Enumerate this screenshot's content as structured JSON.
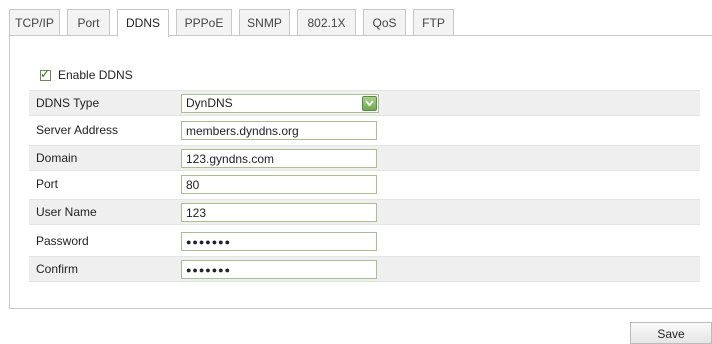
{
  "tabs": [
    {
      "label": "TCP/IP",
      "active": false
    },
    {
      "label": "Port",
      "active": false
    },
    {
      "label": "DDNS",
      "active": true
    },
    {
      "label": "PPPoE",
      "active": false
    },
    {
      "label": "SNMP",
      "active": false
    },
    {
      "label": "802.1X",
      "active": false
    },
    {
      "label": "QoS",
      "active": false
    },
    {
      "label": "FTP",
      "active": false
    }
  ],
  "ddns": {
    "enable_label": "Enable DDNS",
    "enabled": true,
    "type": {
      "label": "DDNS Type",
      "value": "DynDNS"
    },
    "server_address": {
      "label": "Server Address",
      "value": "members.dyndns.org"
    },
    "domain": {
      "label": "Domain",
      "value": "123.gyndns.com"
    },
    "port": {
      "label": "Port",
      "value": "80"
    },
    "user_name": {
      "label": "User Name",
      "value": "123"
    },
    "password": {
      "label": "Password",
      "value": "●●●●●●●"
    },
    "confirm": {
      "label": "Confirm",
      "value": "●●●●●●●"
    }
  },
  "actions": {
    "save_label": "Save"
  },
  "colors": {
    "field_border": "#a9c08a",
    "dropdown_arrow": "#6ea94f",
    "checkbox_tick": "#2c7a1a"
  },
  "icons": {
    "checkbox": "checkmark-icon",
    "dropdown": "chevron-down-icon"
  }
}
